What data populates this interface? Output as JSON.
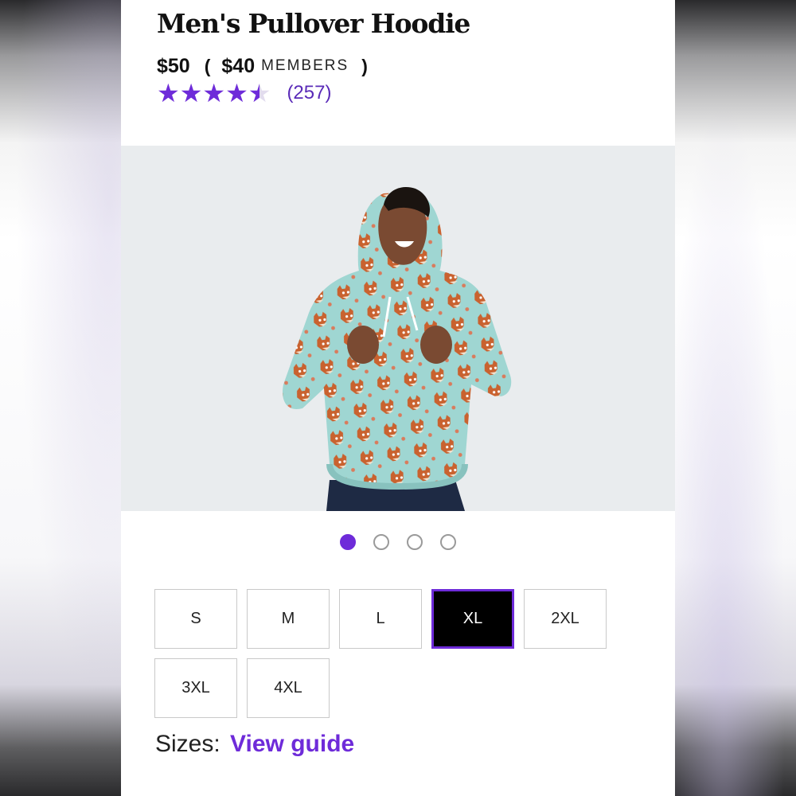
{
  "product": {
    "title": "Men's Pullover Hoodie",
    "price": "$50",
    "paren_open": "(",
    "paren_close": ")",
    "member_price": "$40",
    "members_label": "MEMBERS",
    "rating": 4.5,
    "rating_max": 5,
    "stars_glyph": "★★★★★",
    "review_count": "(257)"
  },
  "gallery": {
    "image_count": 4,
    "active_index": 0,
    "hoodie_color": "#9fd6d2",
    "pattern_color": "#c9622f"
  },
  "sizes": {
    "options": [
      "S",
      "M",
      "L",
      "XL",
      "2XL",
      "3XL",
      "4XL"
    ],
    "selected": "XL",
    "label": "Sizes:",
    "guide_link": "View guide"
  },
  "colors": {
    "accent": "#6e2bd9",
    "selected_bg": "#000000"
  }
}
